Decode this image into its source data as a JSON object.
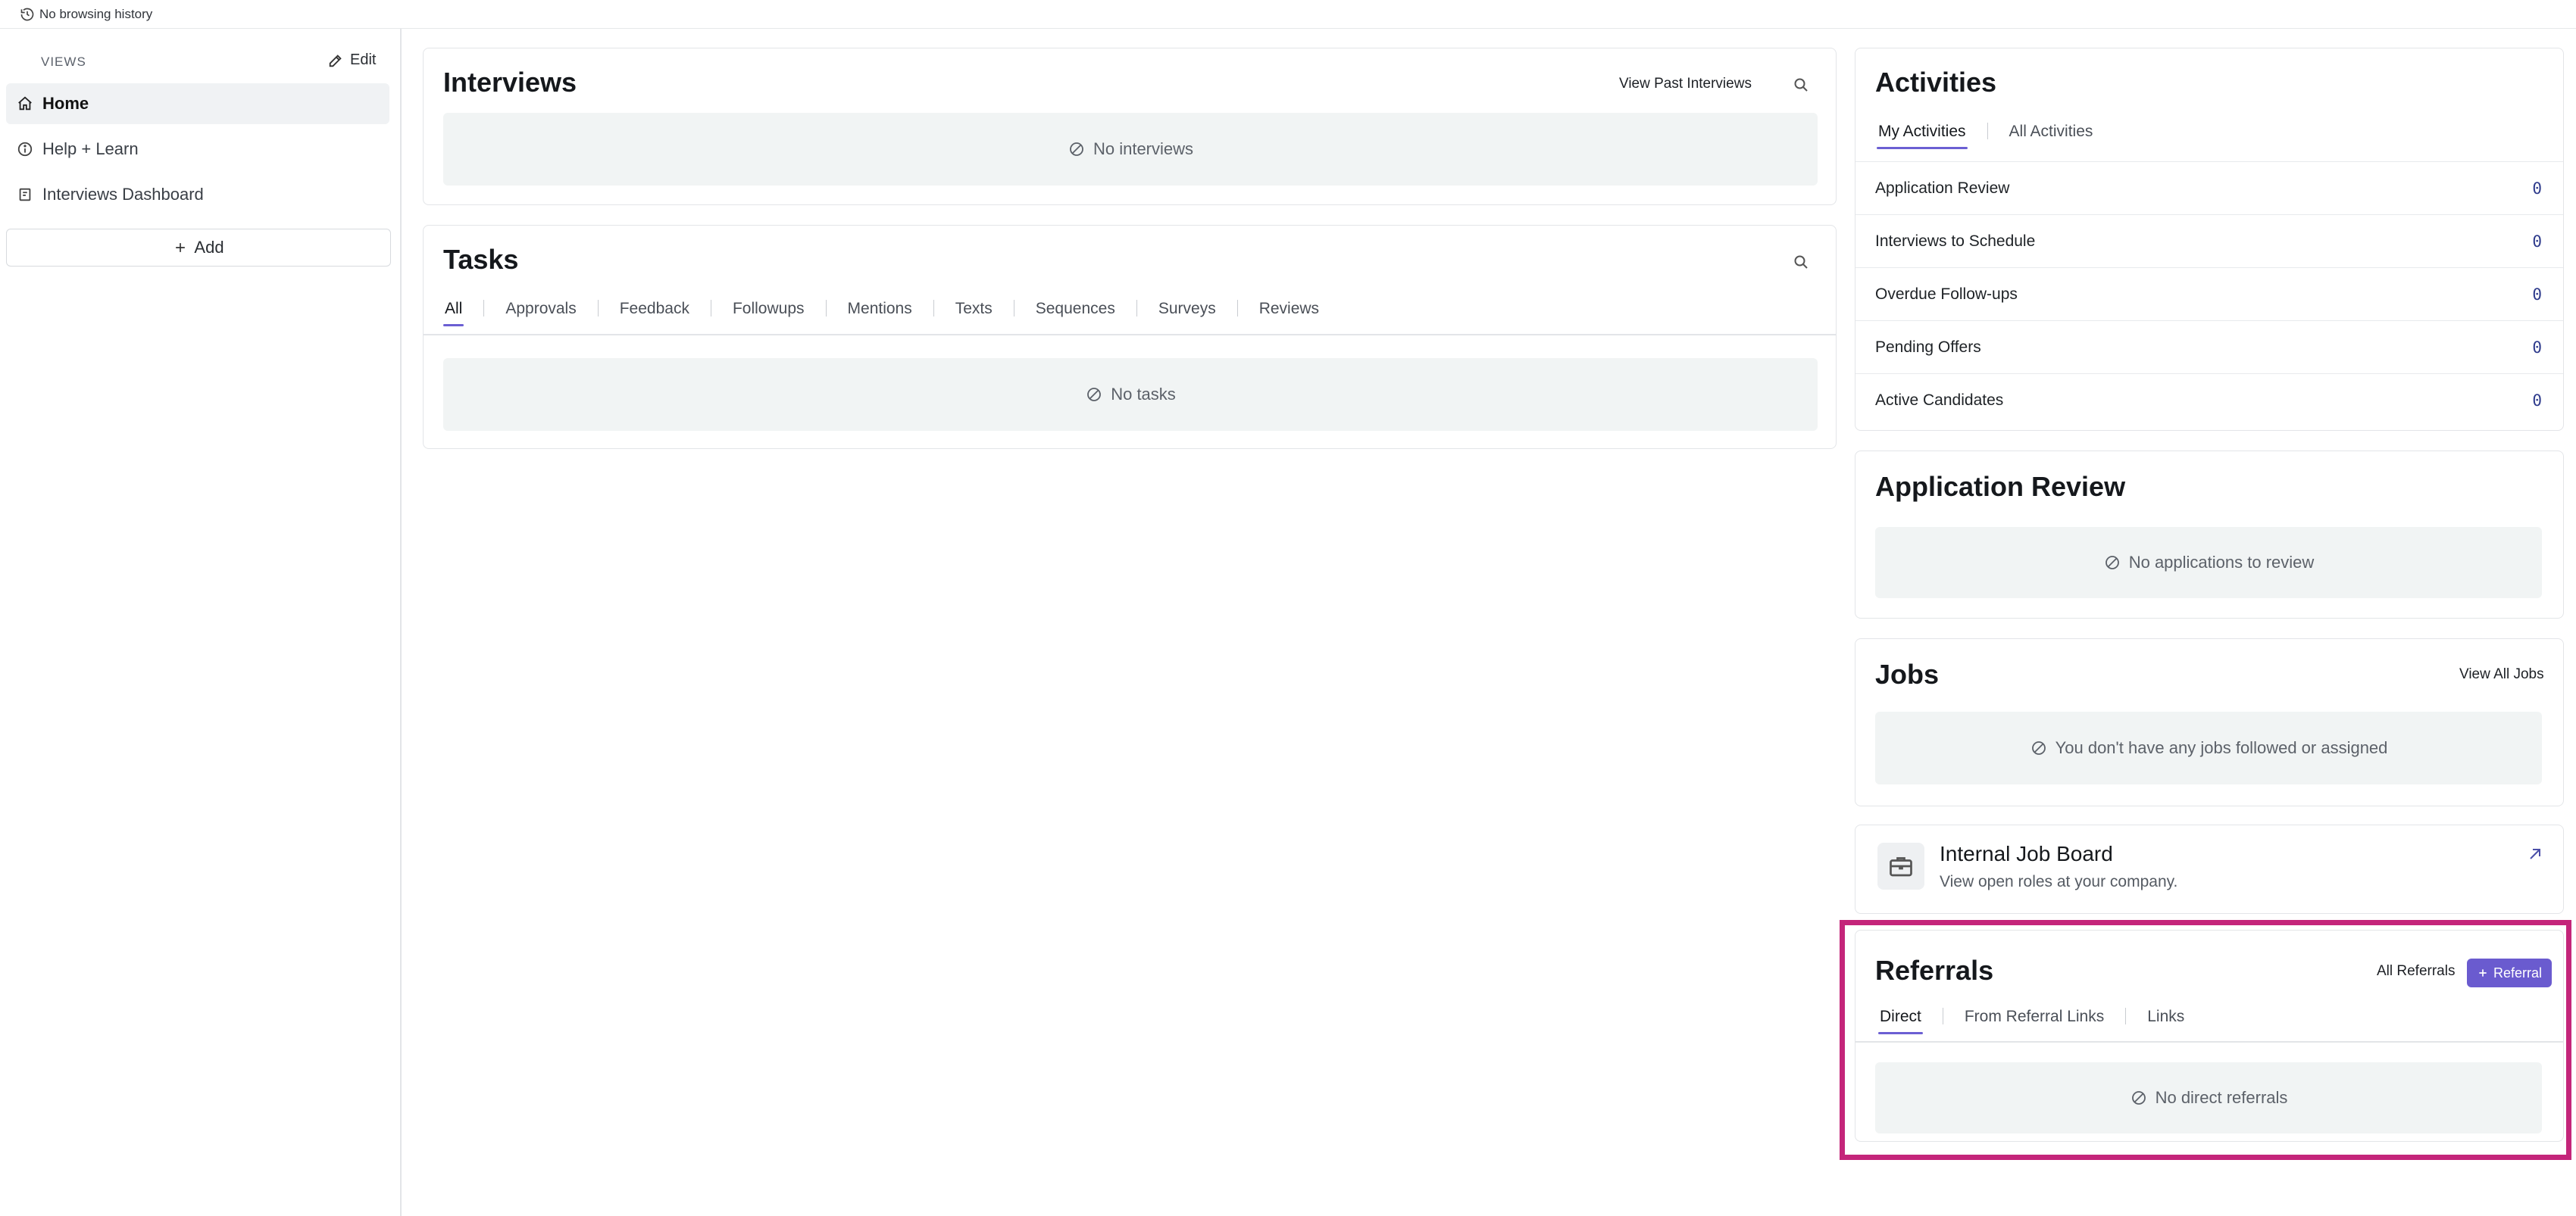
{
  "topbar": {
    "history_text": "No browsing history",
    "icon": "history-icon"
  },
  "sidebar": {
    "views_header": "VIEWS",
    "edit_label": "Edit",
    "items": [
      {
        "label": "Home",
        "icon": "home-icon",
        "active": true
      },
      {
        "label": "Help + Learn",
        "icon": "info-icon",
        "active": false
      },
      {
        "label": "Interviews Dashboard",
        "icon": "dashboard-icon",
        "active": false
      }
    ],
    "add_label": "Add"
  },
  "interviews": {
    "title": "Interviews",
    "view_past_label": "View Past Interviews",
    "empty_text": "No interviews"
  },
  "tasks": {
    "title": "Tasks",
    "tabs": [
      "All",
      "Approvals",
      "Feedback",
      "Followups",
      "Mentions",
      "Texts",
      "Sequences",
      "Surveys",
      "Reviews"
    ],
    "active_tab": "All",
    "empty_text": "No tasks"
  },
  "activities": {
    "title": "Activities",
    "tabs": [
      "My Activities",
      "All Activities"
    ],
    "active_tab": "My Activities",
    "rows": [
      {
        "label": "Application Review",
        "count": "0"
      },
      {
        "label": "Interviews to Schedule",
        "count": "0"
      },
      {
        "label": "Overdue Follow-ups",
        "count": "0"
      },
      {
        "label": "Pending Offers",
        "count": "0"
      },
      {
        "label": "Active Candidates",
        "count": "0"
      }
    ]
  },
  "application_review": {
    "title": "Application Review",
    "empty_text": "No applications to review"
  },
  "jobs": {
    "title": "Jobs",
    "view_all_label": "View All Jobs",
    "empty_text": "You don't have any jobs followed or assigned"
  },
  "internal_job_board": {
    "title": "Internal Job Board",
    "subtitle": "View open roles at your company."
  },
  "referrals": {
    "title": "Referrals",
    "all_label": "All Referrals",
    "add_button_label": "Referral",
    "tabs": [
      "Direct",
      "From Referral Links",
      "Links"
    ],
    "active_tab": "Direct",
    "empty_text": "No direct referrals"
  },
  "colors": {
    "accent": "#6a5bcf",
    "highlight": "#c4257a",
    "empty_bg": "#f1f4f4"
  }
}
